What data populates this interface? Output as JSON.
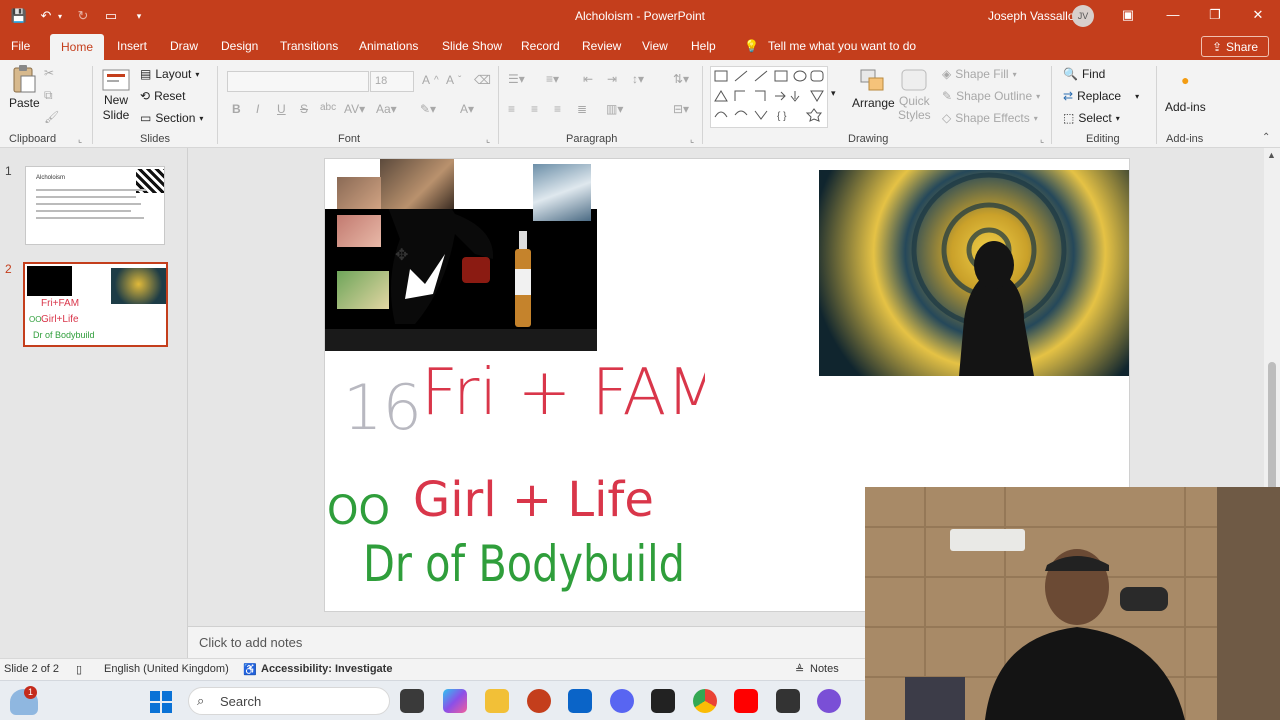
{
  "window": {
    "title": "Alcholoism  -  PowerPoint",
    "user_name": "Joseph Vassallo",
    "user_initials": "JV"
  },
  "tabs": [
    "File",
    "Home",
    "Insert",
    "Draw",
    "Design",
    "Transitions",
    "Animations",
    "Slide Show",
    "Record",
    "Review",
    "View",
    "Help"
  ],
  "tell_me": "Tell me what you want to do",
  "share_label": "Share",
  "ribbon": {
    "clipboard": {
      "paste": "Paste",
      "label": "Clipboard"
    },
    "slides": {
      "new_slide_1": "New",
      "new_slide_2": "Slide",
      "layout": "Layout",
      "reset": "Reset",
      "section": "Section",
      "label": "Slides"
    },
    "font": {
      "size": "18",
      "label": "Font"
    },
    "paragraph": {
      "label": "Paragraph"
    },
    "drawing": {
      "arrange": "Arrange",
      "quick_styles_1": "Quick",
      "quick_styles_2": "Styles",
      "shape_fill": "Shape Fill",
      "shape_outline": "Shape Outline",
      "shape_effects": "Shape Effects",
      "label": "Drawing"
    },
    "editing": {
      "find": "Find",
      "replace": "Replace",
      "select": "Select",
      "label": "Editing"
    },
    "addins": {
      "addins": "Add-ins",
      "label": "Add-ins"
    }
  },
  "thumbnails": [
    {
      "number": "1",
      "title": "Alcholoism"
    },
    {
      "number": "2"
    }
  ],
  "slide": {
    "ink_lines": [
      "16",
      "Fri + FAM",
      "Girl + Life",
      "Dr of Bodybuild"
    ],
    "ink_oo": "OO"
  },
  "notes_placeholder": "Click to add notes",
  "status": {
    "slide_count": "Slide 2 of 2",
    "language": "English (United Kingdom)",
    "accessibility": "Accessibility: Investigate",
    "notes": "Notes"
  },
  "taskbar": {
    "search_placeholder": "Search",
    "notification_count": "1"
  },
  "colors": {
    "accent": "#c43e1c",
    "ink_red": "#d9364a",
    "ink_green": "#2f9e3b"
  }
}
